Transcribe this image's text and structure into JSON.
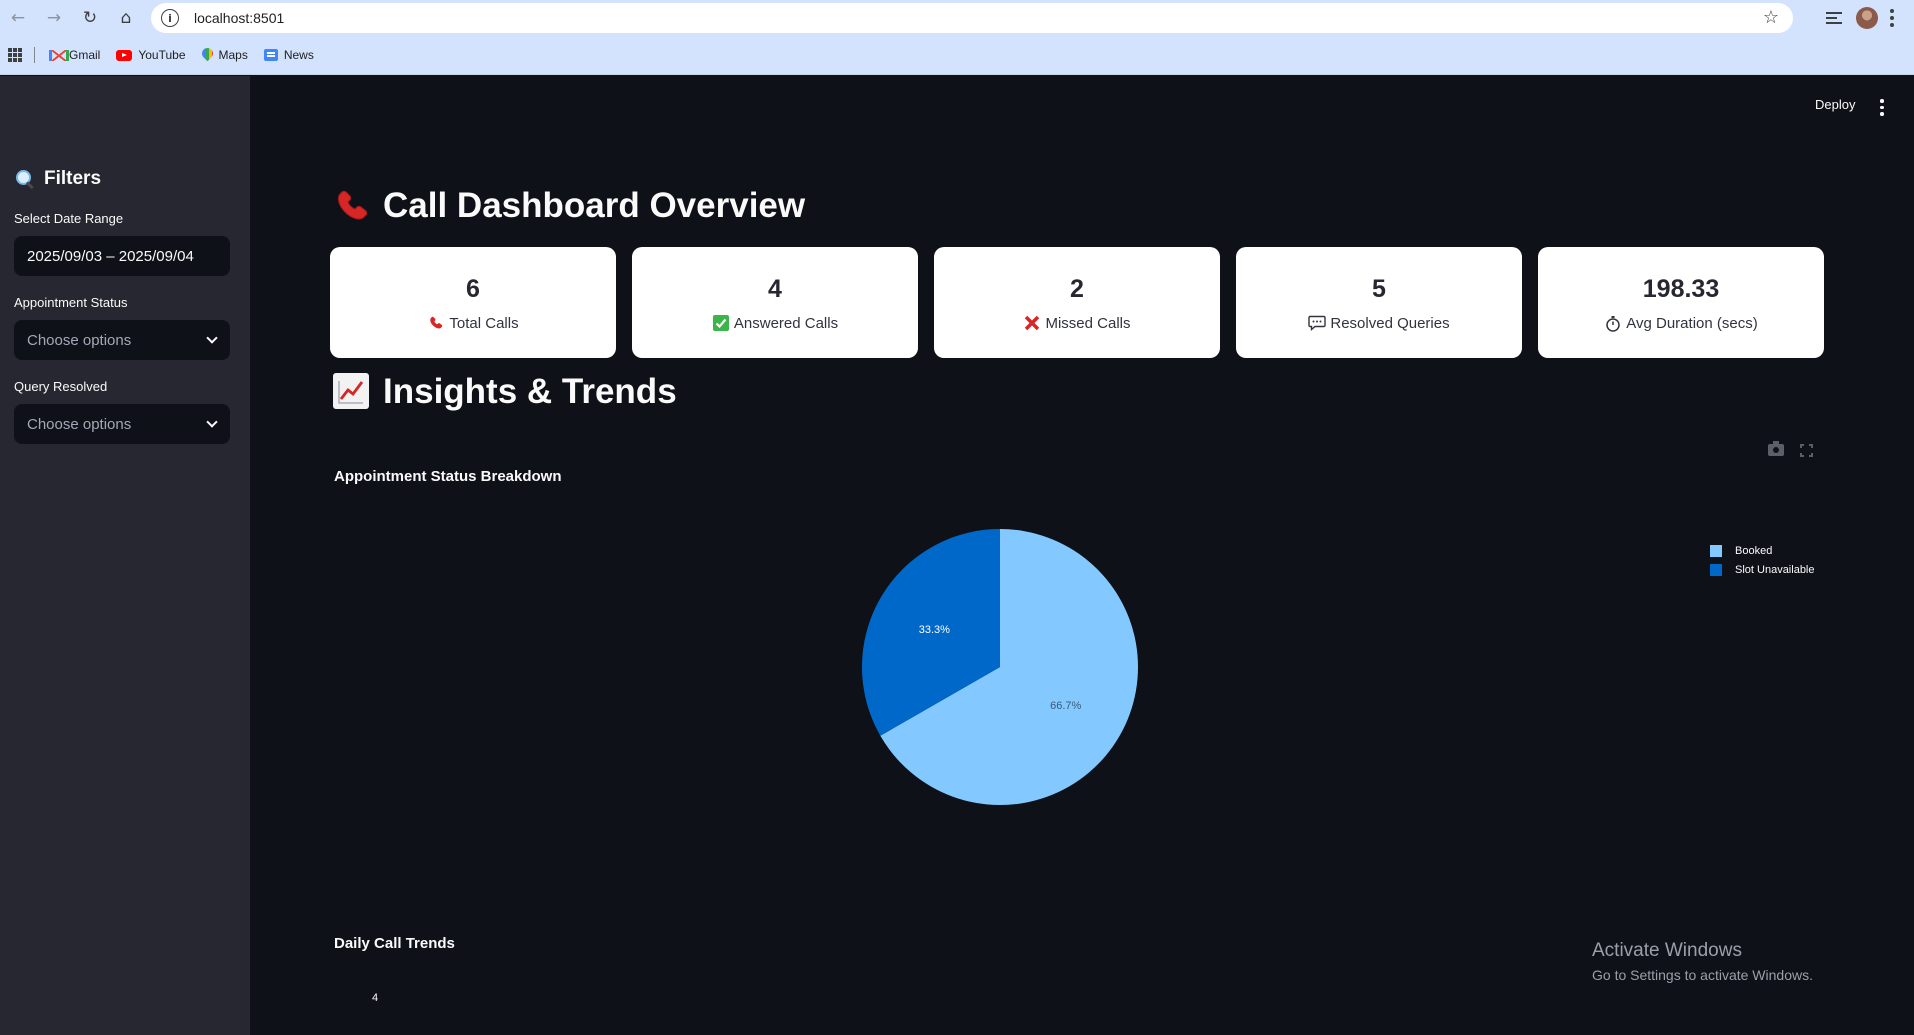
{
  "browser": {
    "url": "localhost:8501",
    "bookmarks": [
      {
        "label": "Gmail"
      },
      {
        "label": "YouTube"
      },
      {
        "label": "Maps"
      },
      {
        "label": "News"
      }
    ]
  },
  "sidebar": {
    "title": "Filters",
    "date_range_label": "Select Date Range",
    "date_range_value": "2025/09/03 – 2025/09/04",
    "appointment_status_label": "Appointment Status",
    "appointment_status_placeholder": "Choose options",
    "query_resolved_label": "Query Resolved",
    "query_resolved_placeholder": "Choose options"
  },
  "header": {
    "deploy_label": "Deploy"
  },
  "main": {
    "title": "Call Dashboard Overview",
    "metrics": [
      {
        "value": "6",
        "label": "Total Calls",
        "icon": "telephone-icon"
      },
      {
        "value": "4",
        "label": "Answered Calls",
        "icon": "check-mark-icon"
      },
      {
        "value": "2",
        "label": "Missed Calls",
        "icon": "cross-mark-icon"
      },
      {
        "value": "5",
        "label": "Resolved Queries",
        "icon": "speech-balloon-icon"
      },
      {
        "value": "198.33",
        "label": "Avg Duration (secs)",
        "icon": "stopwatch-icon"
      }
    ],
    "insights_title": "Insights & Trends",
    "appointment_chart_title": "Appointment Status Breakdown",
    "daily_trends_title": "Daily Call Trends",
    "daily_trends_first_tick": "4"
  },
  "chart_data": {
    "type": "pie",
    "labels": [
      "Booked",
      "Slot Unavailable"
    ],
    "values": [
      66.7,
      33.3
    ],
    "value_labels": [
      "66.7%",
      "33.3%"
    ],
    "colors": [
      "#83c9ff",
      "#0068c9"
    ],
    "legend_position": "top-right"
  },
  "watermark": {
    "line1": "Activate Windows",
    "line2": "Go to Settings to activate Windows."
  }
}
